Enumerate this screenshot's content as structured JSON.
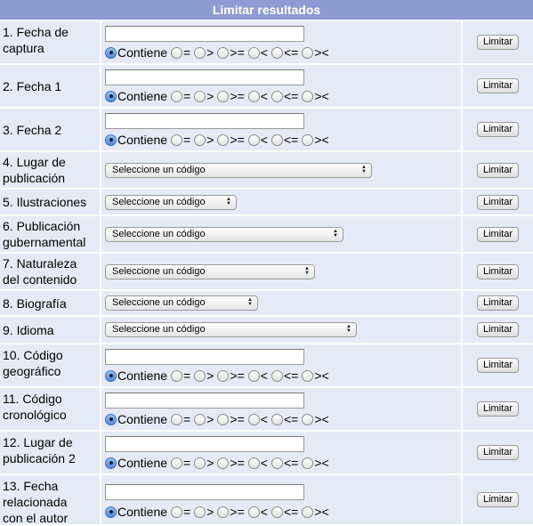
{
  "header": {
    "title": "Limitar resultados"
  },
  "operators": {
    "contains": "Contiene",
    "eq": "=",
    "gt": ">",
    "ge": ">=",
    "lt": "<",
    "le": "<=",
    "ne": "><"
  },
  "select_placeholder": "Seleccione un código",
  "limit_button": "Limitar",
  "rows": [
    {
      "label1": "1. Fecha de",
      "label2": "captura",
      "kind": "text"
    },
    {
      "label1": "2. Fecha 1",
      "label2": "",
      "kind": "text"
    },
    {
      "label1": "3. Fecha 2",
      "label2": "",
      "kind": "text"
    },
    {
      "label1": "4. Lugar de",
      "label2": "publicación",
      "kind": "select"
    },
    {
      "label1": "5. Ilustraciones",
      "label2": "",
      "kind": "select"
    },
    {
      "label1": "6. Publicación",
      "label2": "gubernamental",
      "kind": "select"
    },
    {
      "label1": "7. Naturaleza",
      "label2": "del contenido",
      "kind": "select"
    },
    {
      "label1": "8. Biografía",
      "label2": "",
      "kind": "select"
    },
    {
      "label1": "9. Idioma",
      "label2": "",
      "kind": "select"
    },
    {
      "label1": "10. Código",
      "label2": "geográfico",
      "kind": "text"
    },
    {
      "label1": "11. Código",
      "label2": "cronológico",
      "kind": "text"
    },
    {
      "label1": "12. Lugar de",
      "label2": "publicación 2",
      "kind": "text"
    },
    {
      "label1": "13. Fecha",
      "label2": "relacionada",
      "label3": "con el autor",
      "kind": "text"
    }
  ]
}
